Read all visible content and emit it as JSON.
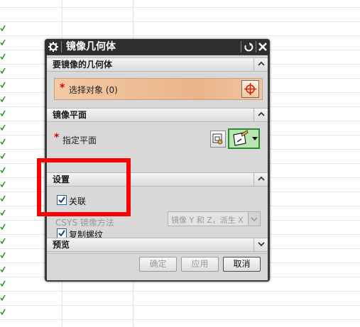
{
  "dialog": {
    "title": "镜像几何体",
    "sections": {
      "geometry": {
        "header": "要镜像的几何体",
        "select_label": "选择对象 (0)"
      },
      "plane": {
        "header": "镜像平面",
        "specify_label": "指定平面"
      },
      "settings": {
        "header": "设置",
        "associative_label": "关联",
        "associative_checked": true,
        "csys_label": "CSYS 镜像方法",
        "csys_value": "镜像 Y 和 Z，派生 X",
        "copy_threads_label": "复制螺纹",
        "copy_threads_checked": true
      },
      "preview": {
        "header": "预览"
      }
    },
    "buttons": {
      "ok": "确定",
      "apply": "应用",
      "cancel": "取消"
    }
  },
  "colors": {
    "highlight_red": "#ff0000",
    "selection_bg": "#eab48a",
    "plane_active_green": "#2f8a2f"
  }
}
